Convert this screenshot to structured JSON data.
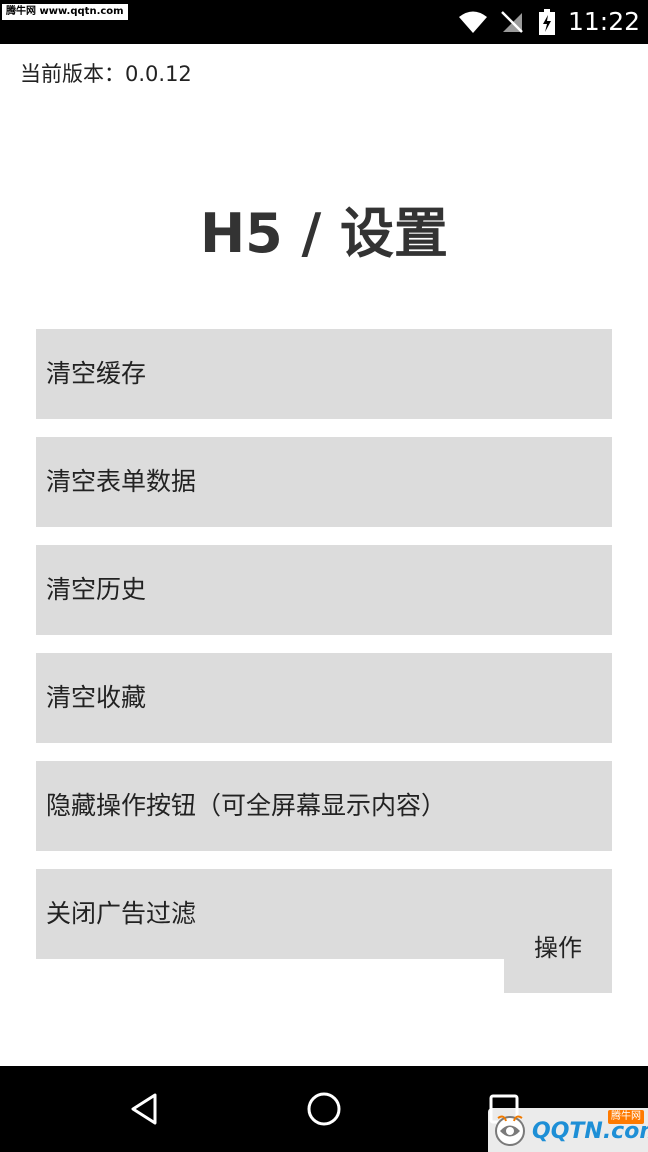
{
  "status_bar": {
    "watermark": "腾牛网 www.qqtn.com",
    "time": "11:22",
    "icons": [
      "wifi-icon",
      "no-signal-icon",
      "battery-charging-icon"
    ]
  },
  "header": {
    "version_label": "当前版本：",
    "version_value": "0.0.12",
    "title": "H5 / 设置"
  },
  "menu": {
    "items": [
      {
        "label": "清空缓存"
      },
      {
        "label": "清空表单数据"
      },
      {
        "label": "清空历史"
      },
      {
        "label": "清空收藏"
      },
      {
        "label": "隐藏操作按钮（可全屏幕显示内容）"
      },
      {
        "label": "关闭广告过滤"
      }
    ],
    "action_button": "操作"
  },
  "nav_bar": {
    "icons": [
      "back-icon",
      "home-icon",
      "recent-apps-icon"
    ]
  },
  "watermark_logo": {
    "text": "QQTN.com",
    "badge": "腾牛网"
  },
  "colors": {
    "status_bar_bg": "#000000",
    "menu_item_bg": "#dcdcdc",
    "title_color": "#333333",
    "logo_blue": "#1e8fd6"
  }
}
